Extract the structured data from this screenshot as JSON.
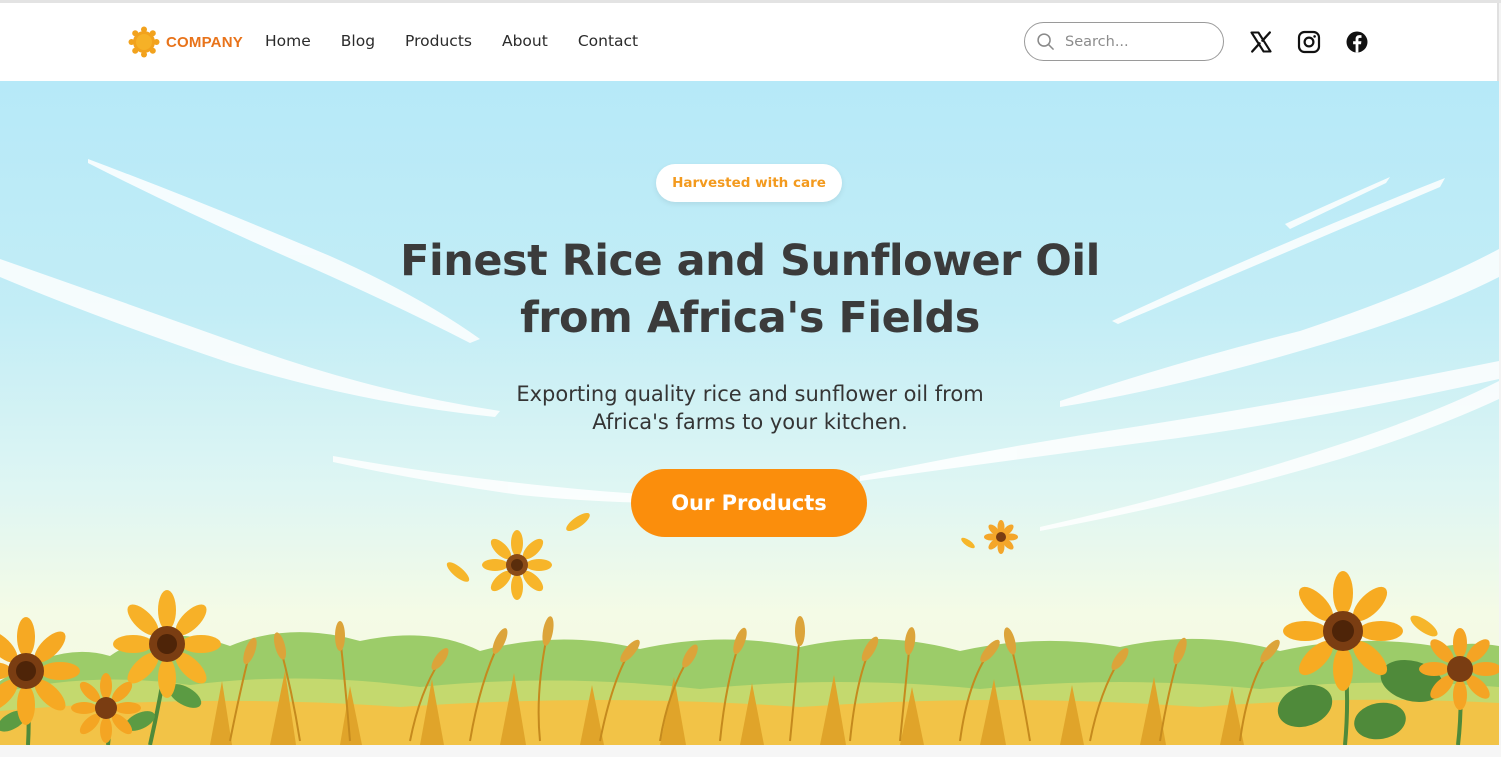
{
  "header": {
    "logo_text": "COMPANY",
    "nav": [
      "Home",
      "Blog",
      "Products",
      "About",
      "Contact"
    ],
    "search_placeholder": "Search...",
    "social_icons": [
      "x-icon",
      "instagram-icon",
      "facebook-icon"
    ]
  },
  "hero": {
    "badge": "Harvested with care",
    "title_line1": "Finest Rice and Sunflower Oil",
    "title_line2": "from Africa's Fields",
    "subtitle_line1": "Exporting quality rice and sunflower oil from",
    "subtitle_line2": "Africa's farms to your kitchen.",
    "cta_label": "Our Products"
  },
  "colors": {
    "accent": "#fb8e0c",
    "logo": "#e8731a",
    "badge_text": "#f39a1e",
    "heading": "#3b3b3b",
    "sky_top": "#b6e9f8",
    "sky_bottom": "#f6f6dd"
  }
}
